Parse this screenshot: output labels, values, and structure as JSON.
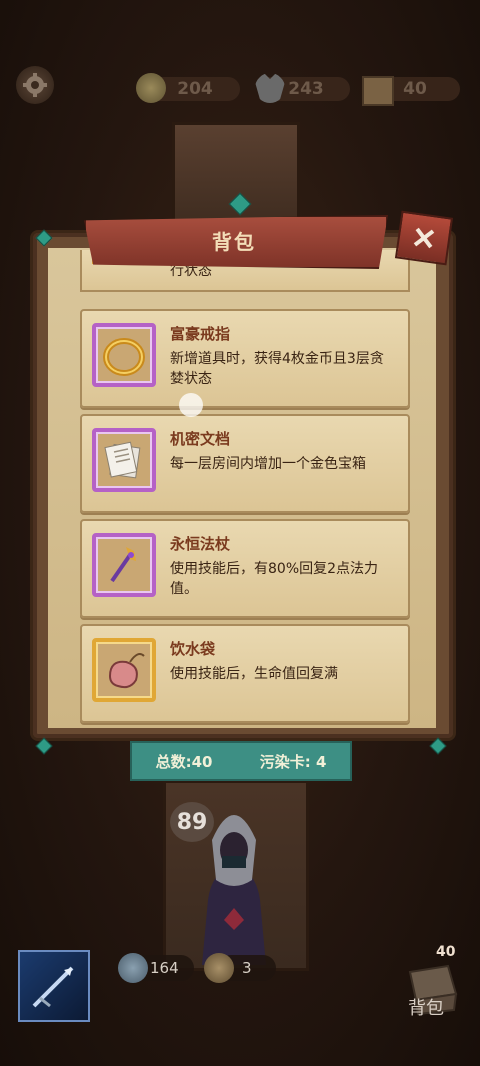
{
  "topbar": {
    "resources": [
      {
        "icon": "coin-icon",
        "value": "204"
      },
      {
        "icon": "wolf-head-icon",
        "value": "243"
      },
      {
        "icon": "crate-icon",
        "value": "40"
      }
    ]
  },
  "panel": {
    "title": "背包",
    "partial_item_text": "行状态",
    "items": [
      {
        "name": "富豪戒指",
        "desc": "新增道具时，获得4枚金币且3层贪婪状态",
        "icon": "gold-ring-icon",
        "rarity": "purple"
      },
      {
        "name": "机密文档",
        "desc": "每一层房间内增加一个金色宝箱",
        "icon": "documents-icon",
        "rarity": "purple"
      },
      {
        "name": "永恒法杖",
        "desc": "使用技能后，有80%回复2点法力值。",
        "icon": "staff-icon",
        "rarity": "purple"
      },
      {
        "name": "饮水袋",
        "desc": "使用技能后，生命值回复满",
        "icon": "waterskin-icon",
        "rarity": "gold"
      }
    ]
  },
  "counts": {
    "total_label": "总数:40",
    "corrupt_label": "污染卡:",
    "corrupt_value": "4"
  },
  "character": {
    "level": "89"
  },
  "bottom": {
    "shield_value": "164",
    "energy_value": "3",
    "bag_count": "40",
    "bag_label": "背包"
  },
  "colors": {
    "accent": "#3d8f84",
    "ribbon": "#a84e3e",
    "rarity_purple": "#b561c6",
    "rarity_gold": "#e0a735"
  }
}
